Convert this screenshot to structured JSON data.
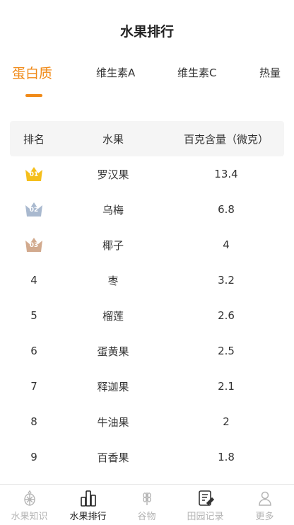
{
  "header": {
    "title": "水果排行"
  },
  "tabs": [
    {
      "label": "蛋白质",
      "active": true
    },
    {
      "label": "维生素A",
      "active": false
    },
    {
      "label": "维生素C",
      "active": false
    },
    {
      "label": "热量",
      "active": false
    }
  ],
  "table": {
    "headers": [
      "排名",
      "水果",
      "百克含量（微克）"
    ],
    "rows": [
      {
        "rank": "01",
        "fruit": "罗汉果",
        "value": "13.4",
        "medal": "gold"
      },
      {
        "rank": "02",
        "fruit": "乌梅",
        "value": "6.8",
        "medal": "silver"
      },
      {
        "rank": "03",
        "fruit": "椰子",
        "value": "4",
        "medal": "bronze"
      },
      {
        "rank": "4",
        "fruit": "枣",
        "value": "3.2"
      },
      {
        "rank": "5",
        "fruit": "榴莲",
        "value": "2.6"
      },
      {
        "rank": "6",
        "fruit": "蛋黄果",
        "value": "2.5"
      },
      {
        "rank": "7",
        "fruit": "释迦果",
        "value": "2.1"
      },
      {
        "rank": "8",
        "fruit": "牛油果",
        "value": "2"
      },
      {
        "rank": "9",
        "fruit": "百香果",
        "value": "1.8"
      }
    ]
  },
  "tabbar": [
    {
      "label": "水果知识",
      "icon": "fruit-knowledge-icon",
      "active": false
    },
    {
      "label": "水果排行",
      "icon": "ranking-icon",
      "active": true
    },
    {
      "label": "谷物",
      "icon": "grain-icon",
      "active": false
    },
    {
      "label": "田园记录",
      "icon": "record-icon",
      "active": false
    },
    {
      "label": "更多",
      "icon": "user-icon",
      "active": false
    }
  ],
  "colors": {
    "accent": "#f08a18",
    "gold": "#f5bf1c",
    "silver": "#a9b9cf",
    "bronze": "#d2aa8e"
  }
}
